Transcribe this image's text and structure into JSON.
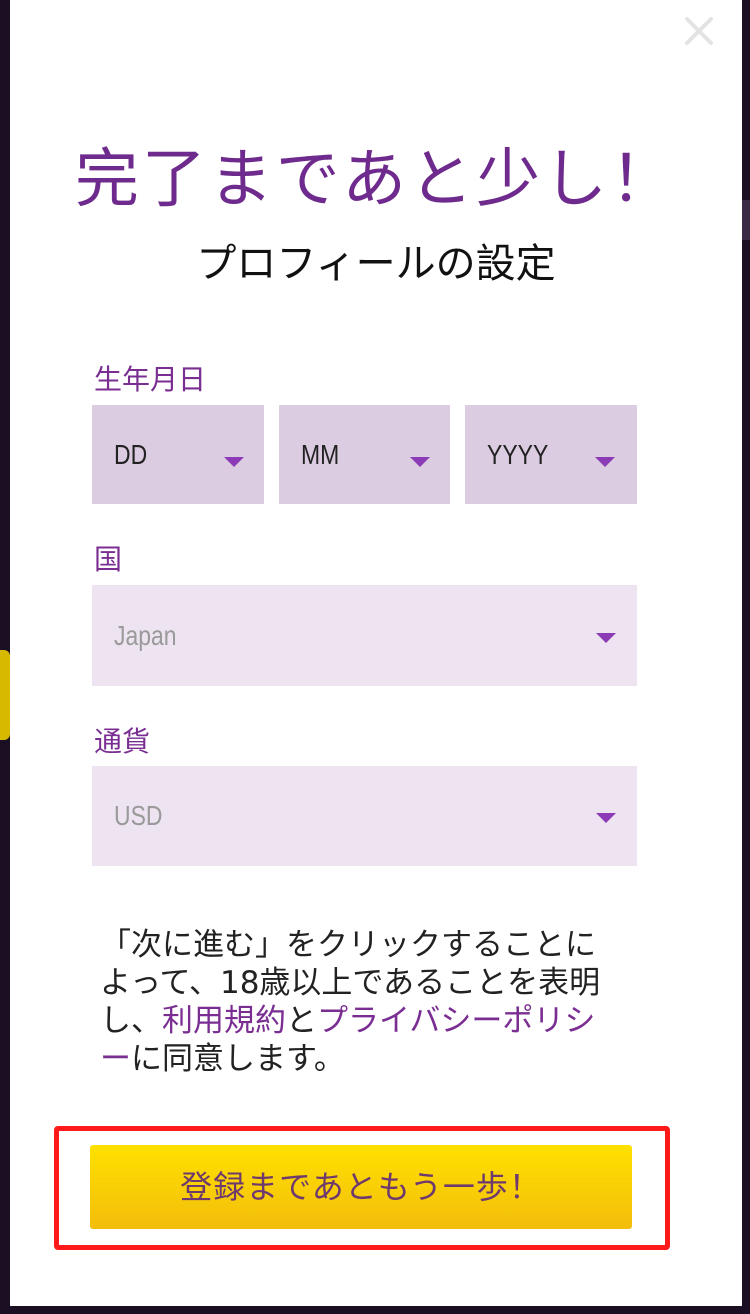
{
  "modal": {
    "title": "完了まであと少し！",
    "subtitle": "プロフィールの設定"
  },
  "birthdate": {
    "label": "生年月日",
    "day": "DD",
    "month": "MM",
    "year": "YYYY"
  },
  "country": {
    "label": "国",
    "value": "Japan"
  },
  "currency": {
    "label": "通貨",
    "value": "USD"
  },
  "notice": {
    "part1": "「次に進む」をクリックすることによって、18歳以上であることを表明し、",
    "terms_link": "利用規約",
    "and": "と",
    "privacy_link": "プライバシーポリシー",
    "part2": "に同意します。"
  },
  "cta": {
    "label": "登録まであともう一歩！"
  },
  "colors": {
    "accent": "#7a2e92",
    "button": "#ffd600",
    "highlight": "#ff1a1a"
  },
  "icons": [
    "close-icon",
    "chevron-down-icon"
  ]
}
